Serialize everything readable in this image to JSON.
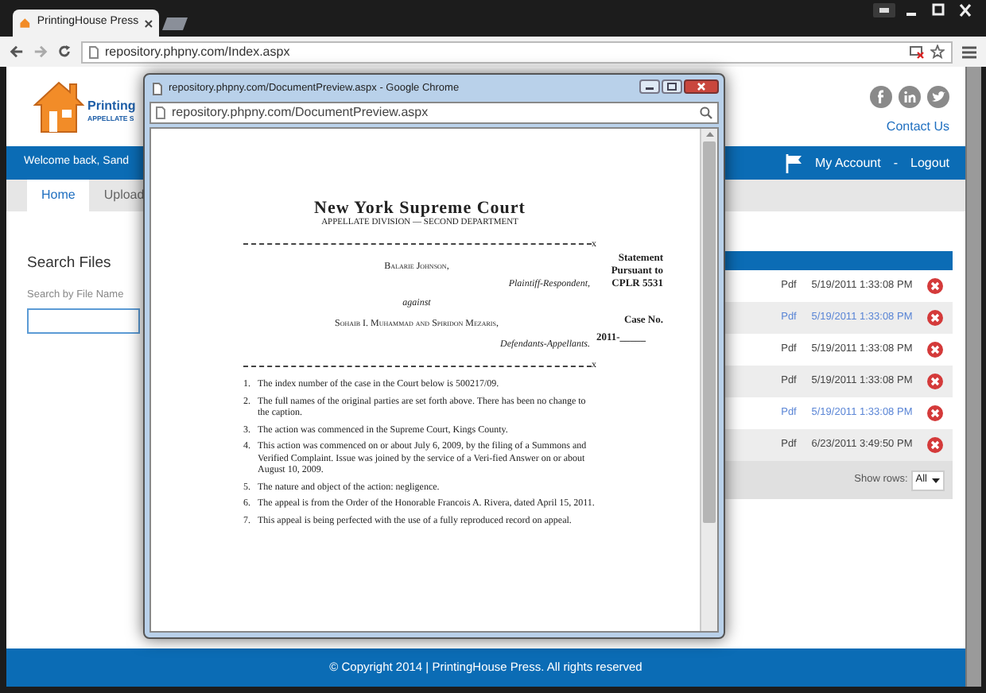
{
  "browser": {
    "tab_title": "PrintingHouse Press",
    "url": "repository.phpny.com/Index.aspx"
  },
  "site": {
    "logo_name": "Printing",
    "logo_tagline": "APPELLATE S",
    "contact_link": "Contact Us",
    "welcome": "Welcome back, Sand",
    "account_link": "My Account",
    "separator": "-",
    "logout_link": "Logout",
    "tabs": [
      {
        "label": "Home",
        "selected": true
      },
      {
        "label": "Upload",
        "selected": false
      }
    ],
    "search": {
      "heading": "Search Files",
      "label": "Search by File Name"
    },
    "files": {
      "rows": [
        {
          "type": "Pdf",
          "date": "5/19/2011 1:33:08 PM",
          "highlighted": false
        },
        {
          "type": "Pdf",
          "date": "5/19/2011 1:33:08 PM",
          "highlighted": true
        },
        {
          "type": "Pdf",
          "date": "5/19/2011 1:33:08 PM",
          "highlighted": false
        },
        {
          "type": "Pdf",
          "date": "5/19/2011 1:33:08 PM",
          "highlighted": false
        },
        {
          "type": "Pdf",
          "date": "5/19/2011 1:33:08 PM",
          "highlighted": true
        },
        {
          "type": "Pdf",
          "date": "6/23/2011 3:49:50 PM",
          "highlighted": false
        }
      ],
      "show_rows_label": "Show rows:",
      "show_rows_value": "All"
    },
    "footer": "© Copyright 2014 | PrintingHouse Press. All rights reserved"
  },
  "popup": {
    "title": "repository.phpny.com/DocumentPreview.aspx - Google Chrome",
    "url": "repository.phpny.com/DocumentPreview.aspx",
    "document": {
      "court": "New York Supreme Court",
      "division": "APPELLATE DIVISION — SECOND DEPARTMENT",
      "rule_end": "x",
      "rule_end_2": "x",
      "plaintiff": "Balarie Johnson,",
      "plaintiff_role": "Plaintiff-Respondent,",
      "versus": "against",
      "defendants": "Sohaib I. Muhammad and Spiridon Mezaris,",
      "defendants_role": "Defendants-Appellants.",
      "statement": "Statement Pursuant to CPLR 5531",
      "case_label": "Case No.",
      "case_number": "2011-_____",
      "items": [
        {
          "number": "1.",
          "text": "The index number of the case in the Court below is 500217/09."
        },
        {
          "number": "2.",
          "text": "The full names of the original parties are set forth above. There has been no change to the caption."
        },
        {
          "number": "3.",
          "text": "The action was commenced in the Supreme Court, Kings County."
        },
        {
          "number": "4.",
          "text": "This action was commenced on or about July 6, 2009, by the filing of a Summons and Verified Complaint. Issue was joined by the service of a Veri-fied Answer on or about August 10, 2009."
        },
        {
          "number": "5.",
          "text": "The nature and object of the action: negligence."
        },
        {
          "number": "6.",
          "text": "The appeal is from the Order of the Honorable Francois A. Rivera, dated April 15, 2011."
        },
        {
          "number": "7.",
          "text": "This appeal is being perfected with the use of a fully reproduced record on appeal."
        }
      ]
    }
  }
}
